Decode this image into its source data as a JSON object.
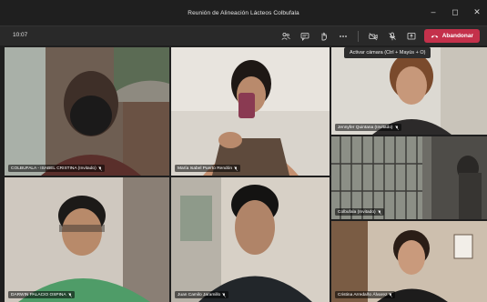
{
  "window": {
    "title": "Reunión de Alineación Lácteos Colbufala",
    "controls": [
      "minimize",
      "restore",
      "close"
    ]
  },
  "toolbar": {
    "timer": "10:07",
    "icons": [
      "participants-icon",
      "chat-icon",
      "raise-hand-icon",
      "more-icon",
      "camera-icon",
      "mic-icon",
      "share-icon"
    ],
    "leave_label": "Abandonar"
  },
  "tooltip": {
    "text": "Activar cámara (Ctrl + Mayús + O)"
  },
  "participants": [
    {
      "name": "COLBUFALA - ISABEL CRISTINA (Invitado)"
    },
    {
      "name": "María Isabel Puerto Rendón"
    },
    {
      "name": "Jennyfer Quintana (Invitado)"
    },
    {
      "name": "Colbufala (Invitado)"
    },
    {
      "name": "DARWIN PALACIO OSPINA"
    },
    {
      "name": "Juan Camilo Jaramillo"
    },
    {
      "name": "Cristina Arredaño Álvarez"
    }
  ],
  "colors": {
    "leave": "#c4314b",
    "background": "#1f1f1f",
    "toolbar": "#292929"
  }
}
